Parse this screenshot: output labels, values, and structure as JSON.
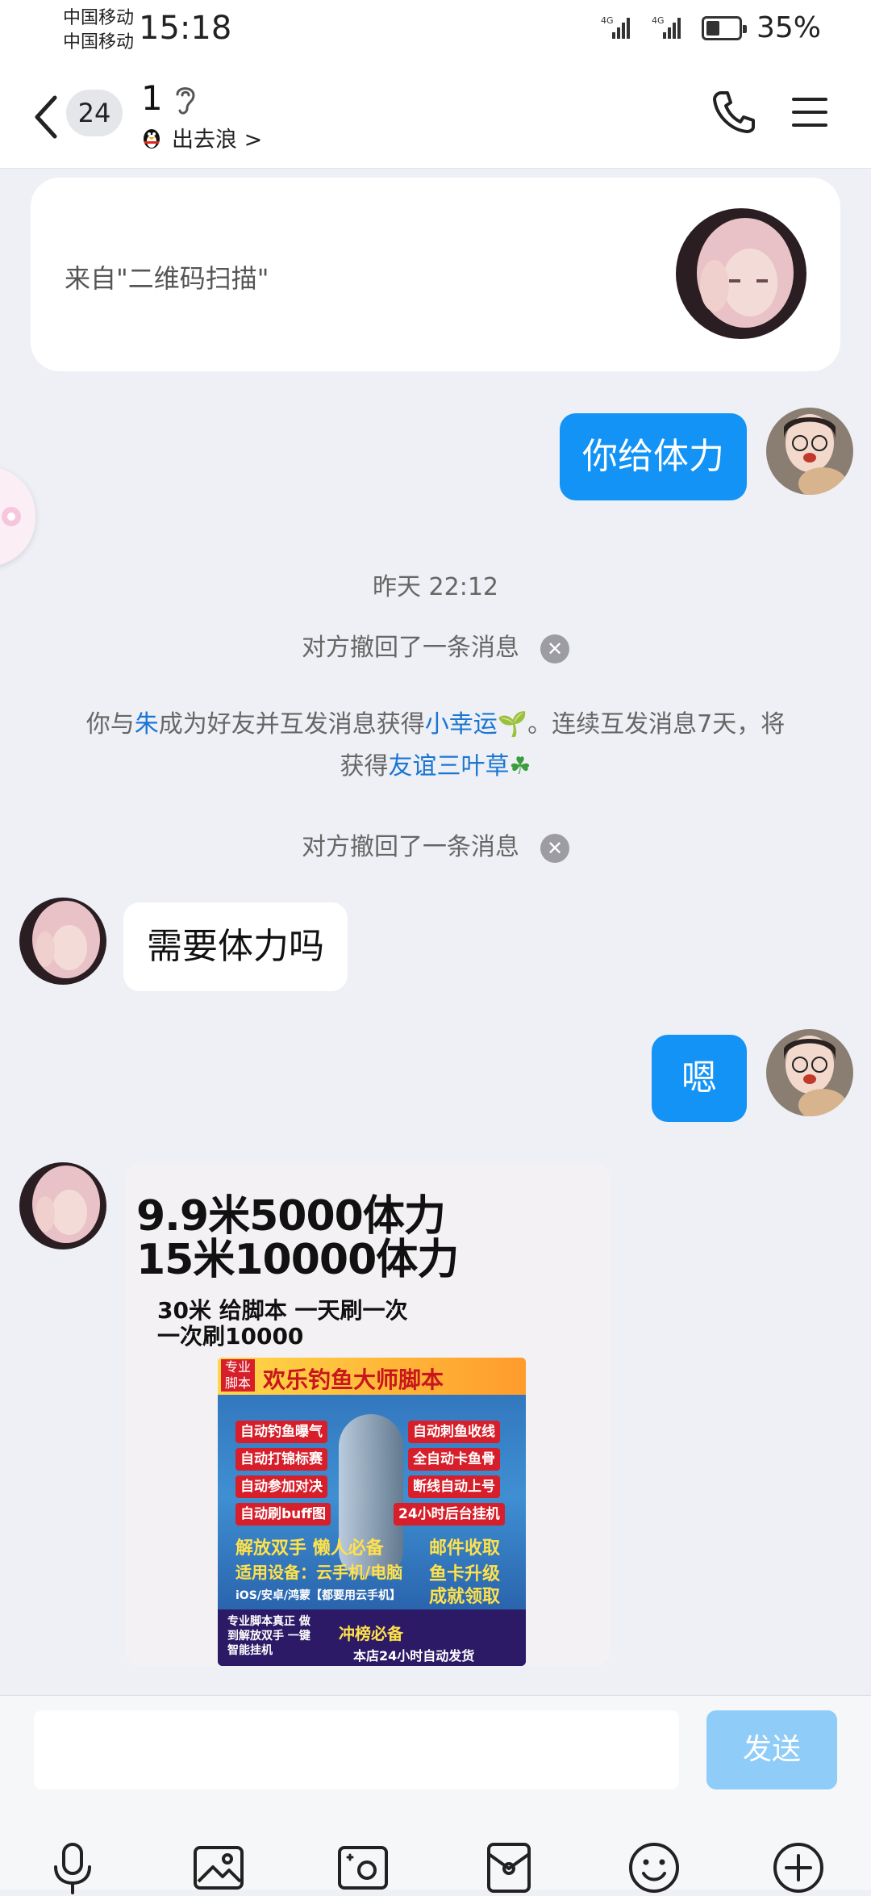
{
  "status_bar": {
    "carrier_1": "中国移动",
    "carrier_2": "中国移动",
    "time": "15:18",
    "signal_1": "4G",
    "signal_2": "4G",
    "battery": "35%"
  },
  "header": {
    "unread_count": "24",
    "title": "1",
    "status": "出去浪 >"
  },
  "card": {
    "source_text": "来自\"二维码扫描\""
  },
  "messages": {
    "m1": "你给体力",
    "timestamp": "昨天 22:12",
    "recall_1": "对方撤回了一条消息",
    "friend_notice": {
      "p1": "你与",
      "name": "朱",
      "p2": "成为好友并互发消息获得",
      "link1": "小幸运",
      "p3": "。连续互发消息7天，将",
      "p4": "获得",
      "link2": "友谊三叶草"
    },
    "recall_2": "对方撤回了一条消息",
    "m2": "需要体力吗",
    "m3": "嗯"
  },
  "promo": {
    "line1": "9.9米5000体力",
    "line2": "15米10000体力",
    "line3": "30米 给脚本 一天刷一次",
    "line4": "一次刷10000",
    "poster": {
      "badge": "专业脚本",
      "name": "欢乐钓鱼大师脚本",
      "tags_left": [
        "自动钓鱼曝气",
        "自动打锦标赛",
        "自动参加对决",
        "自动刷buff图"
      ],
      "tags_right": [
        "自动刺鱼收线",
        "全自动卡鱼骨",
        "断线自动上号",
        "24小时后台挂机"
      ],
      "slogan_1": "解放双手  懒人必备",
      "slogan_2": "邮件收取",
      "device_label": "适用设备：云手机/电脑",
      "slogan_3": "鱼卡升级",
      "device_detail": "iOS/安卓/鸿蒙【都要用云手机】",
      "slogan_4": "成就领取",
      "bottom_left": "专业脚本真正 做到解放双手 一键智能挂机",
      "bottom_mid": "冲榜必备",
      "bottom_right": "本店24小时自动发货"
    }
  },
  "input_bar": {
    "send_label": "发送",
    "placeholder": ""
  },
  "toolbar_icons": [
    "microphone-icon",
    "image-icon",
    "camera-icon",
    "red-packet-icon",
    "emoji-icon",
    "plus-icon"
  ],
  "colors": {
    "accent": "#1393f5",
    "send_disabled": "#8fccf7",
    "link": "#1a76d2",
    "background": "#eef0f5"
  }
}
